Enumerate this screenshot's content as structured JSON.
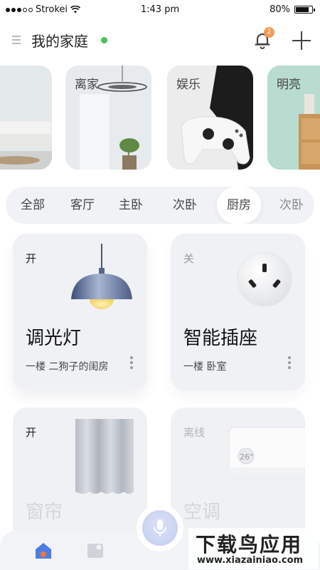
{
  "status_bar": {
    "carrier": "Strokei",
    "time": "1:43 pm",
    "battery": "80%",
    "battery_level": 0.8
  },
  "header": {
    "title": "我的家庭",
    "notification_count": "2"
  },
  "scenes": [
    {
      "label": ""
    },
    {
      "label": "离家"
    },
    {
      "label": "娱乐"
    },
    {
      "label": "明亮"
    }
  ],
  "tabs": [
    {
      "label": "全部",
      "active": false
    },
    {
      "label": "客厅",
      "active": false
    },
    {
      "label": "主卧",
      "active": false
    },
    {
      "label": "次卧",
      "active": false
    },
    {
      "label": "厨房",
      "active": true
    },
    {
      "label": "次卧",
      "active": false
    }
  ],
  "devices": [
    {
      "state": "开",
      "name": "调光灯",
      "location": "一楼  二狗子的闺房",
      "icon": "pendant-lamp-icon"
    },
    {
      "state": "关",
      "name": "智能插座",
      "location": "一楼  卧室",
      "icon": "power-socket-icon"
    },
    {
      "state": "开",
      "name": "窗帘",
      "location": "",
      "icon": "curtain-icon"
    },
    {
      "state": "离线",
      "name": "空调",
      "location": "",
      "icon": "air-conditioner-icon",
      "ac_temp": "26°"
    }
  ],
  "bottom_nav": {
    "items": [
      {
        "icon": "home-icon",
        "active": true
      },
      {
        "icon": "devices-icon",
        "active": false
      }
    ],
    "mic_icon": "microphone-icon"
  },
  "watermark": {
    "title": "下载鸟应用",
    "url": "www.xiazainiao.com"
  },
  "colors": {
    "online": "#49c15b",
    "badge": "#f39a57",
    "accent": "#4a7de8",
    "home_dot": "#f07a2a"
  }
}
